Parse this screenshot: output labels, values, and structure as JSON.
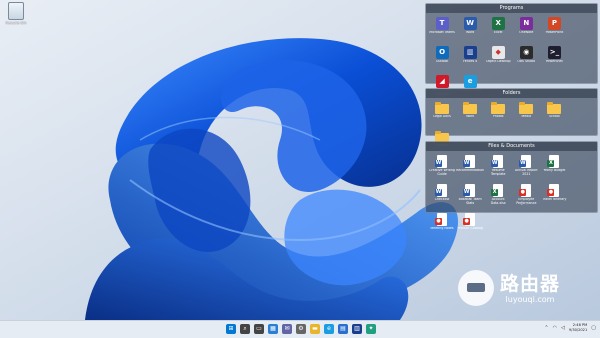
{
  "desktop": {
    "recycle_bin_label": "Recycle Bin"
  },
  "fences": {
    "programs": {
      "title": "Programs",
      "items": [
        {
          "label": "Microsoft Teams",
          "color": "#5b5fc7",
          "glyph": "T",
          "icon": "teams-icon"
        },
        {
          "label": "Word",
          "color": "#2b5cab",
          "glyph": "W",
          "icon": "word-icon"
        },
        {
          "label": "Excel",
          "color": "#1f7244",
          "glyph": "X",
          "icon": "excel-icon"
        },
        {
          "label": "OneNote",
          "color": "#7b2d9b",
          "glyph": "N",
          "icon": "onenote-icon"
        },
        {
          "label": "PowerPoint",
          "color": "#d24726",
          "glyph": "P",
          "icon": "powerpoint-icon"
        },
        {
          "label": "Outlook",
          "color": "#0f6cbd",
          "glyph": "O",
          "icon": "outlook-icon"
        },
        {
          "label": "Fences 4",
          "color": "#1a3f8f",
          "glyph": "▥",
          "icon": "fences-icon"
        },
        {
          "label": "Object Desktop",
          "color": "#e8e8e8",
          "glyph": "◆",
          "icon": "object-desktop-icon"
        },
        {
          "label": "OBS Studio",
          "color": "#2b2b2b",
          "glyph": "◉",
          "icon": "obs-icon"
        },
        {
          "label": "PowerShell",
          "color": "#1e1e2e",
          "glyph": ">_",
          "icon": "powershell-icon"
        },
        {
          "label": "AMD Radeon Software",
          "color": "#d01a2a",
          "glyph": "◢",
          "icon": "amd-icon"
        },
        {
          "label": "Microsoft Edge",
          "color": "#1b9de2",
          "glyph": "e",
          "icon": "edge-icon"
        }
      ]
    },
    "folders": {
      "title": "Folders",
      "items": [
        {
          "label": "Legal Docs"
        },
        {
          "label": "Work"
        },
        {
          "label": "Photos"
        },
        {
          "label": "Media"
        },
        {
          "label": "School"
        },
        {
          "label": "Projects"
        }
      ]
    },
    "files": {
      "title": "Files & Documents",
      "items": [
        {
          "label": "Creative Writing Guide",
          "kind": "word",
          "glyph": "W",
          "color": "#2b5cab"
        },
        {
          "label": "Recommendation",
          "kind": "word",
          "glyph": "W",
          "color": "#2b5cab"
        },
        {
          "label": "Resume Template",
          "kind": "word",
          "glyph": "W",
          "color": "#2b5cab"
        },
        {
          "label": "Annual Report 2021",
          "kind": "word",
          "glyph": "W",
          "color": "#2b5cab"
        },
        {
          "label": "Yearly Budget",
          "kind": "excel",
          "glyph": "X",
          "color": "#1f7244"
        },
        {
          "label": "Checklist",
          "kind": "word",
          "glyph": "W",
          "color": "#2b5cab"
        },
        {
          "label": "Baseball Team Stats",
          "kind": "word",
          "glyph": "W",
          "color": "#2b5cab"
        },
        {
          "label": "Account Data.xlsx",
          "kind": "excel",
          "glyph": "X",
          "color": "#1f7244"
        },
        {
          "label": "Employee Performance Review",
          "kind": "pdf",
          "glyph": "●",
          "color": "#d93025"
        },
        {
          "label": "Travel Itinerary",
          "kind": "pdf",
          "glyph": "●",
          "color": "#d93025"
        },
        {
          "label": "Meeting Notes",
          "kind": "pdf",
          "glyph": "●",
          "color": "#d93025"
        },
        {
          "label": "Product Catalog",
          "kind": "pdf",
          "glyph": "●",
          "color": "#d93025"
        }
      ]
    }
  },
  "taskbar": {
    "icons": [
      {
        "name": "start-icon",
        "glyph": "⊞",
        "color": "#0078d4"
      },
      {
        "name": "search-icon",
        "glyph": "⌕",
        "color": "#444"
      },
      {
        "name": "task-view-icon",
        "glyph": "▭",
        "color": "#444"
      },
      {
        "name": "widgets-icon",
        "glyph": "▦",
        "color": "#2a7fd4"
      },
      {
        "name": "chat-icon",
        "glyph": "✉",
        "color": "#6264a7"
      },
      {
        "name": "settings-icon",
        "glyph": "⚙",
        "color": "#666"
      },
      {
        "name": "file-explorer-icon",
        "glyph": "▬",
        "color": "#e8b52c"
      },
      {
        "name": "edge-icon",
        "glyph": "e",
        "color": "#1b9de2"
      },
      {
        "name": "store-icon",
        "glyph": "▤",
        "color": "#2a6fcf"
      },
      {
        "name": "fences-icon",
        "glyph": "▥",
        "color": "#1a3f8f"
      },
      {
        "name": "app-icon",
        "glyph": "✦",
        "color": "#20a080"
      }
    ],
    "time": "2:46 PM",
    "date": "9/30/2021"
  },
  "watermark": {
    "cn": "路由器",
    "en": "luyouqi.com"
  }
}
